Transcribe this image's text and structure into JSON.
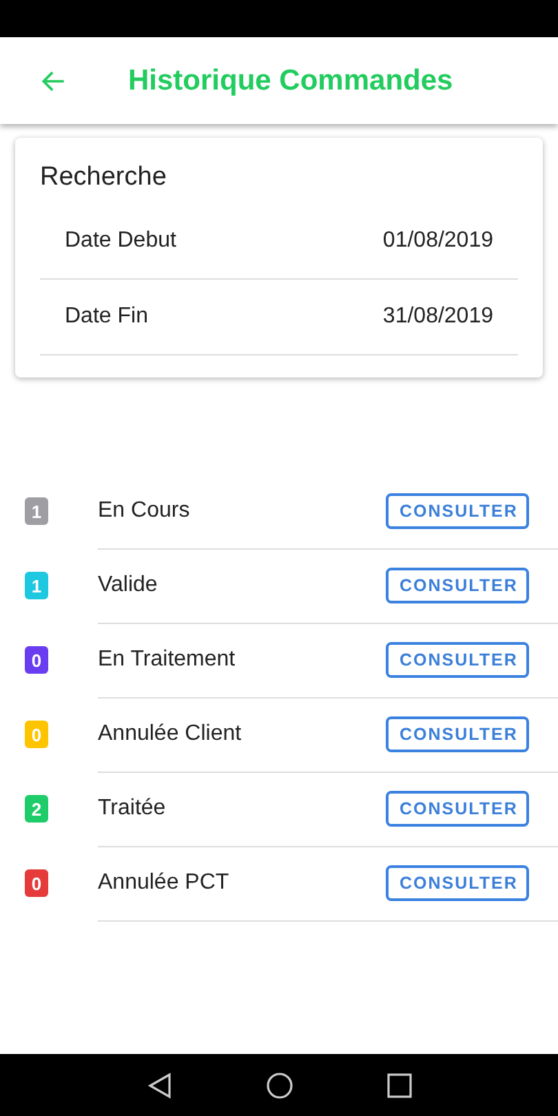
{
  "app_bar": {
    "title": "Historique Commandes"
  },
  "search": {
    "title": "Recherche",
    "fields": [
      {
        "label": "Date Debut",
        "value": "01/08/2019"
      },
      {
        "label": "Date Fin",
        "value": "31/08/2019"
      }
    ]
  },
  "statuses": [
    {
      "count": "1",
      "color": "#9e9ea3",
      "name": "En Cours",
      "action": "CONSULTER"
    },
    {
      "count": "1",
      "color": "#1ec8e0",
      "name": "Valide",
      "action": "CONSULTER"
    },
    {
      "count": "0",
      "color": "#6a3df0",
      "name": "En Traitement",
      "action": "CONSULTER"
    },
    {
      "count": "0",
      "color": "#ffc400",
      "name": "Annulée Client",
      "action": "CONSULTER"
    },
    {
      "count": "2",
      "color": "#1fcc6a",
      "name": "Traitée",
      "action": "CONSULTER"
    },
    {
      "count": "0",
      "color": "#e53b3b",
      "name": "Annulée PCT",
      "action": "CONSULTER"
    }
  ]
}
